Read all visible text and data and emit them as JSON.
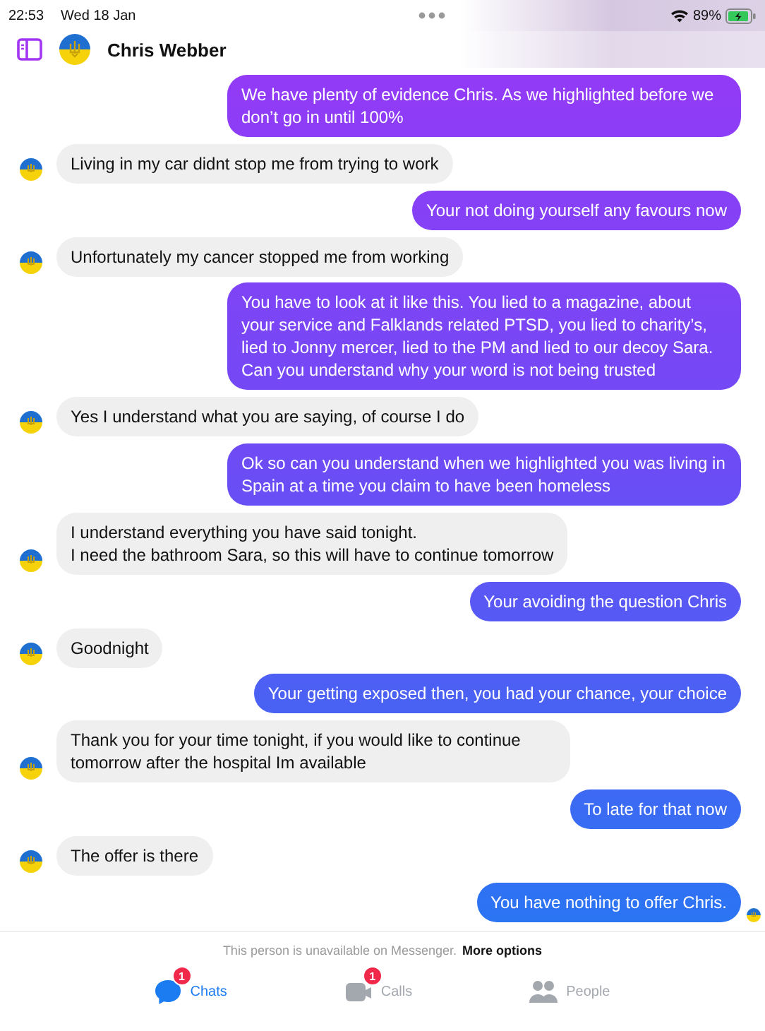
{
  "status_bar": {
    "time": "22:53",
    "date": "Wed 18 Jan",
    "battery": "89%"
  },
  "header": {
    "contact_name": "Chris Webber"
  },
  "messages": [
    {
      "kind": "sent",
      "text": "We have plenty of evidence Chris. As we highlighted before we don’t go in until 100%",
      "seen": false
    },
    {
      "kind": "received",
      "text": "Living in my car didnt stop me from trying to work"
    },
    {
      "kind": "sent",
      "text": "Your not doing yourself any favours now",
      "seen": false
    },
    {
      "kind": "received",
      "text": "Unfortunately my cancer stopped me from working"
    },
    {
      "kind": "sent",
      "text": "You have to look at it like this. You lied to a magazine, about your service and Falklands related PTSD, you lied to charity’s, lied to Jonny mercer, lied to the PM and lied to our decoy Sara. Can you understand why your word is not being trusted",
      "seen": false
    },
    {
      "kind": "received",
      "text": "Yes I understand what you are saying, of course I do"
    },
    {
      "kind": "sent",
      "text": "Ok so can you understand when we highlighted you was living in Spain at a time you claim to have been homeless",
      "seen": false
    },
    {
      "kind": "received",
      "text": "I understand everything you have said tonight.\nI need the bathroom Sara, so this will have to continue tomorrow"
    },
    {
      "kind": "sent",
      "text": "Your avoiding the question Chris",
      "seen": false
    },
    {
      "kind": "received",
      "text": "Goodnight"
    },
    {
      "kind": "sent",
      "text": "Your getting exposed then, you had your chance, your choice",
      "seen": false
    },
    {
      "kind": "received",
      "text": "Thank you for your time tonight, if you would like to continue tomorrow after the hospital Im available"
    },
    {
      "kind": "sent",
      "text": "To late for that now",
      "seen": false
    },
    {
      "kind": "received",
      "text": "The offer is there"
    },
    {
      "kind": "sent",
      "text": "You have nothing to offer Chris.",
      "seen": true
    }
  ],
  "notice": {
    "text": "This person is unavailable on Messenger.",
    "link": "More options"
  },
  "tabs": [
    {
      "label": "Chats",
      "selected": true,
      "badge": "1",
      "kind": "chats"
    },
    {
      "label": "Calls",
      "selected": false,
      "badge": "1",
      "kind": "calls"
    },
    {
      "label": "People",
      "selected": false,
      "kind": "people"
    }
  ]
}
